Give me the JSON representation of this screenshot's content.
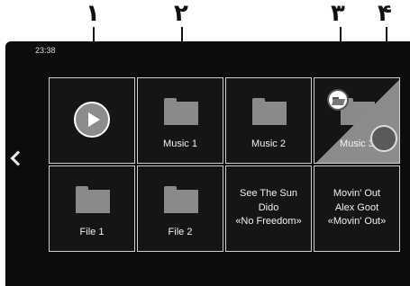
{
  "callouts": [
    "١",
    "٢",
    "٣",
    "۴"
  ],
  "status_bar": {
    "time": "23:38"
  },
  "nav": {
    "back_icon": "chevron-left-icon"
  },
  "tiles": [
    {
      "kind": "play",
      "icon": "play-icon",
      "label": ""
    },
    {
      "kind": "folder",
      "icon": "folder-icon",
      "label": "Music 1"
    },
    {
      "kind": "folder",
      "icon": "folder-icon",
      "label": "Music 2"
    },
    {
      "kind": "folder-selected",
      "icon": "folder-open-icon",
      "label": "Music 3"
    },
    {
      "kind": "folder",
      "icon": "folder-icon",
      "label": "File 1"
    },
    {
      "kind": "folder",
      "icon": "folder-icon",
      "label": "File 2"
    },
    {
      "kind": "track",
      "title": "See The Sun",
      "artist": "Dido",
      "album": "«No Freedom»"
    },
    {
      "kind": "track",
      "title": "Movin' Out",
      "artist": "Alex Goot",
      "album": "«Movin' Out»"
    }
  ],
  "colors": {
    "background": "#0c0c0c",
    "tile_border": "#d0d0d0",
    "accent_gray": "#8c8c8c"
  }
}
